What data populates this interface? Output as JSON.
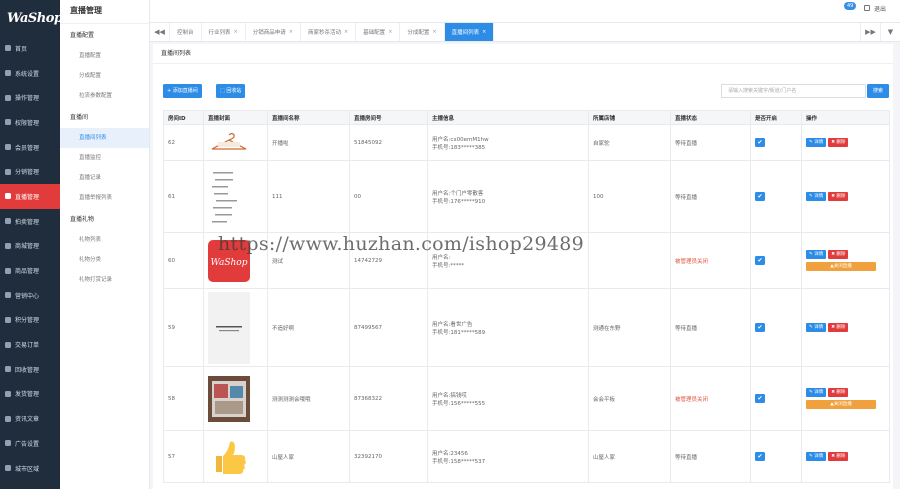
{
  "brand": {
    "logo_text": "WaShop",
    "logo_sub": "微商"
  },
  "sidebar": {
    "items": [
      {
        "label": "首页"
      },
      {
        "label": "系统设置"
      },
      {
        "label": "操作管理"
      },
      {
        "label": "权限管理"
      },
      {
        "label": "会员管理"
      },
      {
        "label": "分销管理"
      },
      {
        "label": "直播管理"
      },
      {
        "label": "拍卖管理"
      },
      {
        "label": "商城管理"
      },
      {
        "label": "商品管理"
      },
      {
        "label": "营销中心"
      },
      {
        "label": "积分管理"
      },
      {
        "label": "交易订单"
      },
      {
        "label": "回收管理"
      },
      {
        "label": "发货管理"
      },
      {
        "label": "资讯文章"
      },
      {
        "label": "广告设置"
      },
      {
        "label": "城市区域"
      },
      {
        "label": "消息通知"
      }
    ],
    "active_index": 6
  },
  "subpanel": {
    "title": "直播管理",
    "groups": [
      {
        "label": "直播配置",
        "links": [
          "直播配置",
          "分成配置",
          "拉流参数配置"
        ]
      },
      {
        "label": "直播间",
        "links": [
          "直播间列表",
          "直播监控",
          "直播记录",
          "直播举报列表"
        ]
      },
      {
        "label": "直播礼物",
        "links": [
          "礼物列表",
          "礼物分类",
          "礼物打赏记录"
        ]
      }
    ],
    "active_link": "直播间列表"
  },
  "topbar": {
    "badge": "49",
    "logout": "退出"
  },
  "tabs": {
    "items": [
      "控制台",
      "行业列表",
      "分销商品申请",
      "商家秒杀活动",
      "基础配置",
      "分成配置",
      "直播间列表"
    ],
    "active_index": 6,
    "close_glyph": "×",
    "left_arrow": "◀◀",
    "right_arrow": "▶▶",
    "more": "▼"
  },
  "main": {
    "title": "直播间列表",
    "add_button": "+ 添加直播间",
    "recycle_button": "回收站",
    "search_placeholder": "请输入搜索关键字/街道/门户名",
    "search_button": "搜索"
  },
  "table": {
    "columns": [
      "房间ID",
      "直播封面",
      "直播间名称",
      "直播房间号",
      "主播信息",
      "所属店铺",
      "直播状态",
      "是否开启",
      "操作"
    ],
    "rows": [
      {
        "id": "62",
        "name": "开播啦",
        "room": "51845092",
        "anchor_user": "用户名:cx00emM1hw",
        "anchor_phone": "手机号:183*****385",
        "shop": "自家驼",
        "status": "等待直播",
        "status_type": "wait",
        "enabled": true,
        "cover": "hanger",
        "close_btn": false
      },
      {
        "id": "61",
        "name": "111",
        "room": "00",
        "anchor_user": "用户名:个门户零散客",
        "anchor_phone": "手机号:176*****910",
        "shop": "100",
        "status": "等待直播",
        "status_type": "wait",
        "enabled": true,
        "cover": "text",
        "close_btn": false
      },
      {
        "id": "60",
        "name": "测试",
        "room": "14742729",
        "anchor_user": "用户名:",
        "anchor_phone": "手机号:*****",
        "shop": "",
        "status": "被管理员关闭",
        "status_type": "closed",
        "enabled": true,
        "cover": "washop",
        "close_btn": true
      },
      {
        "id": "59",
        "name": "不造好啊",
        "room": "87499567",
        "anchor_user": "用户名:看世广告",
        "anchor_phone": "手机号:181*****589",
        "shop": "测通在东野",
        "status": "等待直播",
        "status_type": "wait",
        "enabled": true,
        "cover": "box",
        "close_btn": false
      },
      {
        "id": "58",
        "name": "测测测测会哦哦",
        "room": "87368322",
        "anchor_user": "用户名:搞钱哎",
        "anchor_phone": "手机号:156*****555",
        "shop": "会会平板",
        "status": "被管理员关闭",
        "status_type": "closed",
        "enabled": true,
        "cover": "photo",
        "close_btn": true
      },
      {
        "id": "57",
        "name": "山屋人家",
        "room": "32392170",
        "anchor_user": "用户名:23456",
        "anchor_phone": "手机号:158*****537",
        "shop": "山屋人家",
        "status": "等待直播",
        "status_type": "wait",
        "enabled": true,
        "cover": "thumb",
        "close_btn": false
      }
    ],
    "op_edit": "✎ 详情",
    "op_delete": "✖ 删除",
    "op_close": "▲关闭直播",
    "check_glyph": "✔"
  },
  "watermark": "https://www.huzhan.com/ishop29489",
  "colors": {
    "sidebar_bg": "#1f2d3d",
    "active_red": "#e23b3b",
    "primary_blue": "#2d8ce6",
    "warn_orange": "#f0a03c"
  }
}
